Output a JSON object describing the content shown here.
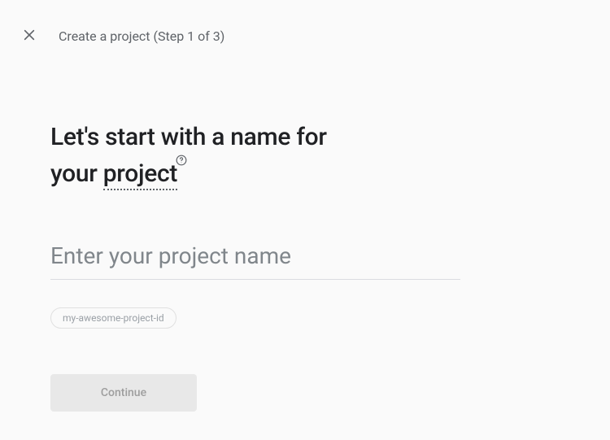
{
  "header": {
    "title": "Create a project (Step 1 of 3)"
  },
  "main": {
    "heading_part1": "Let's start with a name for your ",
    "heading_underlined": "project",
    "input_placeholder": "Enter your project name",
    "input_value": "",
    "project_id_example": "my-awesome-project-id",
    "continue_label": "Continue"
  }
}
